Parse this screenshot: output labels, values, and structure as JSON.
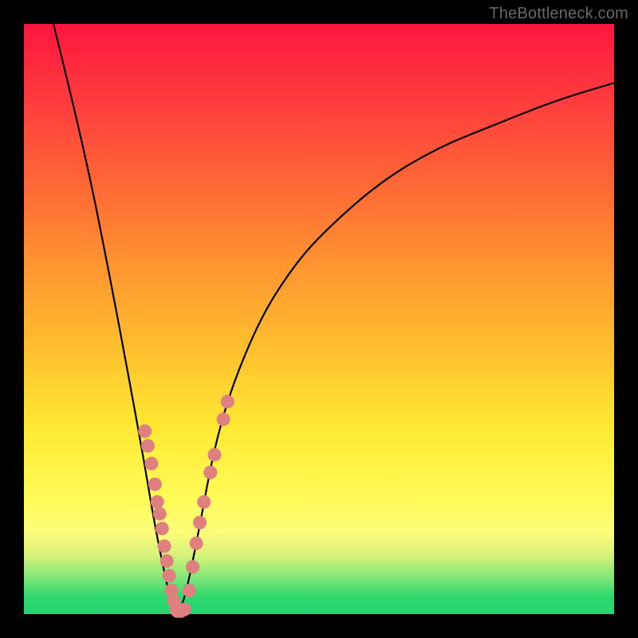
{
  "watermark": "TheBottleneck.com",
  "colors": {
    "dot_fill": "#e07f7f",
    "curve_stroke": "#000000",
    "gradient_top": "#ff153f",
    "gradient_bottom": "#24d56e",
    "background": "#000000"
  },
  "chart_data": {
    "type": "line",
    "title": "",
    "xlabel": "",
    "ylabel": "",
    "xlim": [
      0,
      100
    ],
    "ylim": [
      0,
      100
    ],
    "note": "Axis labels and tick labels are not rendered in the image; values are estimated in normalized 0–100 coordinates from pixel positions.",
    "series": [
      {
        "name": "curve",
        "x": [
          5,
          10,
          15,
          20,
          22,
          24,
          25,
          26,
          27,
          28,
          30,
          32,
          35,
          40,
          45,
          50,
          60,
          70,
          80,
          90,
          100
        ],
        "y": [
          100,
          80,
          55,
          28,
          16,
          6,
          2,
          0,
          2,
          6,
          16,
          27,
          38,
          50,
          58,
          64,
          73,
          79,
          83,
          87,
          90
        ]
      }
    ],
    "points": [
      {
        "name": "left-cluster",
        "coords": [
          {
            "x": 20.5,
            "y": 31
          },
          {
            "x": 21.0,
            "y": 28.5
          },
          {
            "x": 21.6,
            "y": 25.5
          },
          {
            "x": 22.2,
            "y": 22
          },
          {
            "x": 22.6,
            "y": 19
          },
          {
            "x": 23.0,
            "y": 17
          },
          {
            "x": 23.4,
            "y": 14.5
          },
          {
            "x": 23.8,
            "y": 11.5
          },
          {
            "x": 24.2,
            "y": 9
          },
          {
            "x": 24.6,
            "y": 6.5
          },
          {
            "x": 25.0,
            "y": 4
          },
          {
            "x": 25.4,
            "y": 2.2
          },
          {
            "x": 25.8,
            "y": 1
          }
        ]
      },
      {
        "name": "bottom-cluster",
        "coords": [
          {
            "x": 26.0,
            "y": 0.5
          },
          {
            "x": 26.6,
            "y": 0.5
          },
          {
            "x": 27.2,
            "y": 0.8
          }
        ]
      },
      {
        "name": "right-cluster",
        "coords": [
          {
            "x": 28.0,
            "y": 4
          },
          {
            "x": 28.6,
            "y": 8
          },
          {
            "x": 29.2,
            "y": 12
          },
          {
            "x": 29.8,
            "y": 15.5
          },
          {
            "x": 30.5,
            "y": 19
          },
          {
            "x": 31.6,
            "y": 24
          },
          {
            "x": 32.3,
            "y": 27
          },
          {
            "x": 33.8,
            "y": 33
          },
          {
            "x": 34.5,
            "y": 36
          }
        ]
      }
    ]
  }
}
